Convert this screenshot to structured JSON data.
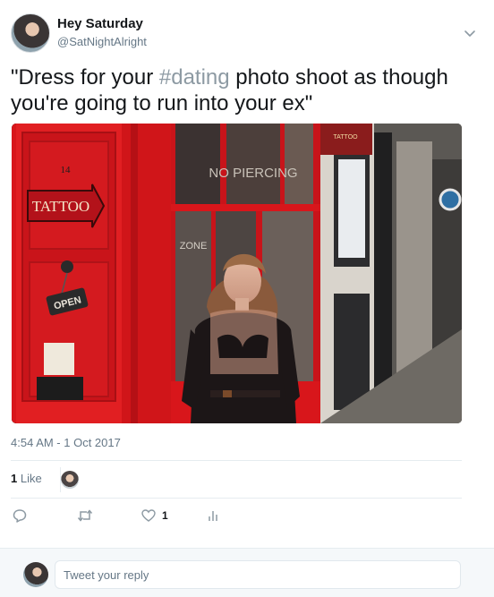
{
  "user": {
    "display_name": "Hey Saturday",
    "handle": "@SatNightAlright"
  },
  "tweet": {
    "text_before": "\"Dress for your ",
    "hashtag": "#dating",
    "text_after": " photo shoot as though you're going to run into your ex\"",
    "timestamp": "4:54 AM - 1 Oct 2017",
    "media_signs": {
      "door_number": "14",
      "tattoo_sign": "TATTOO",
      "open_sign": "OPEN",
      "window_sign": "NO PIERCING",
      "window_sign_2": "ZONE",
      "shop_sign": "TATTOO"
    }
  },
  "engagement": {
    "likes_number": "1",
    "likes_label": " Like",
    "like_action_count": "1"
  },
  "actions": [
    "reply-icon",
    "retweet-icon",
    "like-icon",
    "analytics-icon"
  ],
  "reply": {
    "placeholder": "Tweet your reply"
  },
  "colors": {
    "hashtag": "#8d9aa3",
    "secondary_text": "#657786",
    "border": "#e6ecf0",
    "door_red": "#d8161b"
  }
}
